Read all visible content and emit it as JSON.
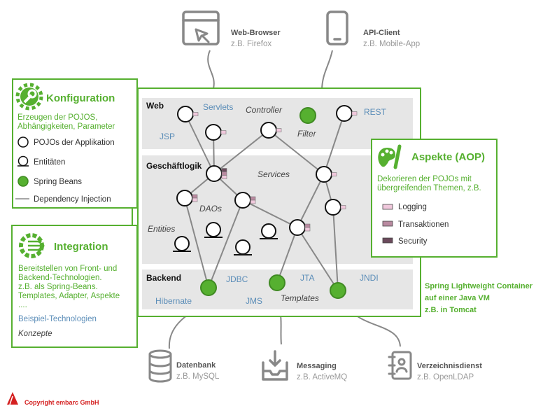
{
  "colors": {
    "green": "#56b030",
    "logging": "#f0c8dc",
    "transaktionen": "#b98aa0",
    "security": "#6b4a5c",
    "band": "#e6e6e6",
    "tech": "#5b8db8"
  },
  "external": {
    "browser": {
      "icon": "browser-window-cursor-icon",
      "title": "Web-Browser",
      "sub": "z.B. Firefox"
    },
    "api": {
      "icon": "smartphone-icon",
      "title": "API-Client",
      "sub": "z.B. Mobile-App"
    },
    "db": {
      "icon": "database-icon",
      "title": "Datenbank",
      "sub": "z.B. MySQL"
    },
    "msg": {
      "icon": "inbox-download-icon",
      "title": "Messaging",
      "sub": "z.B. ActiveMQ"
    },
    "dir": {
      "icon": "contact-book-icon",
      "title": "Verzeichnisdienst",
      "sub": "z.B. OpenLDAP"
    }
  },
  "konfiguration": {
    "icon": "wrench-gear-icon",
    "title": "Konfiguration",
    "desc": [
      "Erzeugen der POJOS,",
      "Abhängigkeiten, Parameter"
    ],
    "legend": [
      "POJOs der Applikation",
      "Entitäten",
      "Spring Beans",
      "Dependency Injection"
    ]
  },
  "integration": {
    "icon": "gear-circuit-icon",
    "title": "Integration",
    "desc": [
      "Bereitstellen von Front- und",
      "Backend-Technologien.",
      "z.B. als Spring-Beans.",
      "Templates, Adapter, Aspekte",
      "...."
    ],
    "tech_label": "Beispiel-Technologien",
    "concept_label": "Konzepte"
  },
  "aspekte": {
    "icon": "palette-brush-icon",
    "title": "Aspekte (AOP)",
    "desc": [
      "Dekorieren der POJOs mit",
      "übergreifenden Themen, z.B."
    ],
    "legend": [
      "Logging",
      "Transaktionen",
      "Security"
    ]
  },
  "container": {
    "web": {
      "title": "Web",
      "servlets": "Servlets",
      "controller": "Controller",
      "filter": "Filter",
      "rest": "REST",
      "jsp": "JSP"
    },
    "logic": {
      "title": "Geschäftlogik",
      "services": "Services",
      "daos": "DAOs",
      "entities": "Entities"
    },
    "backend": {
      "title": "Backend",
      "jdbc": "JDBC",
      "jta": "JTA",
      "jndi": "JNDI",
      "hibernate": "Hibernate",
      "jms": "JMS",
      "templates": "Templates"
    },
    "caption": [
      "Spring Lightweight Container",
      "auf einer Java VM",
      "z.B. in Tomcat"
    ]
  },
  "copyright": "Copyright embarc GmbH"
}
